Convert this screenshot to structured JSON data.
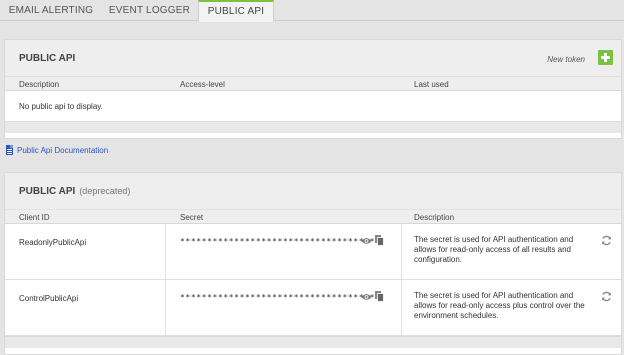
{
  "tabs": [
    {
      "label": "EMAIL ALERTING"
    },
    {
      "label": "EVENT LOGGER"
    },
    {
      "label": "PUBLIC API"
    }
  ],
  "public_api": {
    "title": "PUBLIC API",
    "new_token_label": "New token",
    "columns": [
      "Description",
      "Access-level",
      "Last used"
    ],
    "empty_text": "No public api to display."
  },
  "doc_link": {
    "label": "Public Api Documentation",
    "icon": "document-icon"
  },
  "deprecated": {
    "title": "PUBLIC API",
    "subtitle": "(deprecated)",
    "columns": [
      "Client ID",
      "Secret",
      "Description"
    ],
    "rows": [
      {
        "client_id": "ReadonlyPublicApi",
        "secret": "*************************************",
        "description": "The secret is used for API authentication and allows for read-only access of all results and configuration."
      },
      {
        "client_id": "ControlPublicApi",
        "secret": "*************************************",
        "description": "The secret is used for API authentication and allows for read-only access plus control over the environment schedules."
      }
    ]
  },
  "colors": {
    "accent": "#7cc242",
    "link": "#2a55c2",
    "background": "#e4e4e4"
  },
  "icons": [
    "add-icon",
    "document-icon",
    "eye-icon",
    "copy-icon",
    "refresh-icon"
  ]
}
